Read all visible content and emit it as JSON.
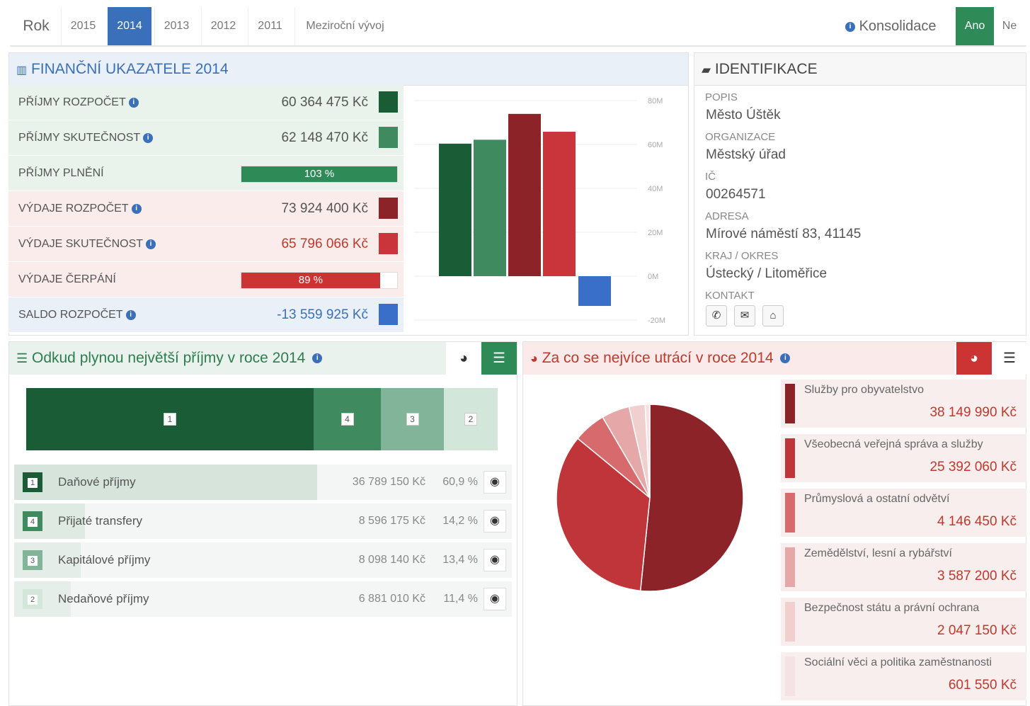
{
  "yearbar": {
    "label": "Rok",
    "years": [
      "2015",
      "2014",
      "2013",
      "2012",
      "2011",
      "Meziroční vývoj"
    ],
    "active_year": "2014",
    "consolidation_label": "Konsolidace",
    "yes_label": "Ano",
    "no_label": "Ne",
    "active_consolidation": "Ano"
  },
  "fin": {
    "title": "FINANČNÍ UKAZATELE 2014",
    "rows": [
      {
        "label": "PŘÍJMY ROZPOČET",
        "value": "60 364 475 Kč",
        "color": "#1a5c36"
      },
      {
        "label": "PŘÍJMY SKUTEČNOST",
        "value": "62 148 470 Kč",
        "color": "#3f8a5e"
      },
      {
        "label": "PŘÍJMY PLNĚNÍ",
        "bar_text": "103 %",
        "bar_fraction": 1.0,
        "color": "#2e8b57"
      },
      {
        "label": "VÝDAJE ROZPOČET",
        "value": "73 924 400 Kč",
        "color": "#8b2328"
      },
      {
        "label": "VÝDAJE SKUTEČNOST",
        "value": "65 796 066 Kč",
        "color": "#c9353a"
      },
      {
        "label": "VÝDAJE ČERPÁNÍ",
        "bar_text": "89 %",
        "bar_fraction": 0.89,
        "color": "#cc3333"
      },
      {
        "label": "SALDO ROZPOČET",
        "value": "-13 559 925 Kč",
        "color": "#3a6fc9"
      }
    ]
  },
  "chart_data": {
    "type": "bar",
    "categories": [
      "PŘÍJMY ROZPOČET",
      "PŘÍJMY SKUTEČNOST",
      "VÝDAJE ROZPOČET",
      "VÝDAJE SKUTEČNOST",
      "SALDO ROZPOČET"
    ],
    "values": [
      60364475,
      62148470,
      73924400,
      65796066,
      -13559925
    ],
    "colors": [
      "#1a5c36",
      "#3f8a5e",
      "#8b2328",
      "#c9353a",
      "#3a6fc9"
    ],
    "ylim": [
      -20000000,
      80000000
    ],
    "ytick_labels": [
      "80M",
      "60M",
      "40M",
      "20M",
      "0M",
      "-20M"
    ],
    "ytick_values": [
      80000000,
      60000000,
      40000000,
      20000000,
      0,
      -20000000
    ],
    "grid": true
  },
  "ident": {
    "title": "IDENTIFIKACE",
    "fields": [
      {
        "label": "POPIS",
        "value": "Město Úštěk"
      },
      {
        "label": "ORGANIZACE",
        "value": "Městský úřad"
      },
      {
        "label": "IČ",
        "value": "00264571"
      },
      {
        "label": "ADRESA",
        "value": "Mírové náměstí 83, 41145"
      },
      {
        "label": "KRAJ / OKRES",
        "value": "Ústecký / Litoměřice"
      }
    ],
    "contact_label": "KONTAKT",
    "contact_icons": [
      "phone-icon",
      "envelope-icon",
      "home-icon"
    ]
  },
  "income": {
    "title": "Odkud plynou největší příjmy v roce 2014",
    "segments": [
      {
        "num": "1",
        "share": 60.9,
        "color": "#1a5c36"
      },
      {
        "num": "4",
        "share": 14.2,
        "color": "#3f8a5e"
      },
      {
        "num": "3",
        "share": 13.4,
        "color": "#82b49a"
      },
      {
        "num": "2",
        "share": 11.4,
        "color": "#d3e6da"
      }
    ],
    "rows": [
      {
        "num": "1",
        "name": "Daňové příjmy",
        "amount": "36 789 150 Kč",
        "pct": "60,9 %",
        "share": 60.9,
        "color": "#1a5c36",
        "fill": "#d6e4db"
      },
      {
        "num": "4",
        "name": "Přijaté transfery",
        "amount": "8 596 175 Kč",
        "pct": "14,2 %",
        "share": 14.2,
        "color": "#3f8a5e",
        "fill": "#dfeae3"
      },
      {
        "num": "3",
        "name": "Kapitálové příjmy",
        "amount": "8 098 140 Kč",
        "pct": "13,4 %",
        "share": 13.4,
        "color": "#82b49a",
        "fill": "#e4ede7"
      },
      {
        "num": "2",
        "name": "Nedaňové příjmy",
        "amount": "6 881 010 Kč",
        "pct": "11,4 %",
        "share": 11.4,
        "color": "#d3e6da",
        "fill": "#e6eee9"
      }
    ]
  },
  "spend": {
    "title": "Za co se nejvíce utrácí v roce 2014",
    "items": [
      {
        "name": "Služby pro obyvatelstvo",
        "amount": "38 149 990 Kč",
        "value": 38149990,
        "color": "#8b2328"
      },
      {
        "name": "Všeobecná veřejná správa a služby",
        "amount": "25 392 060 Kč",
        "value": 25392060,
        "color": "#c0353a"
      },
      {
        "name": "Průmyslová a ostatní odvětví",
        "amount": "4 146 450 Kč",
        "value": 4146450,
        "color": "#d66a6d"
      },
      {
        "name": "Zemědělství, lesní a rybářství",
        "amount": "3 587 200 Kč",
        "value": 3587200,
        "color": "#e6a7a8"
      },
      {
        "name": "Bezpečnost státu a právní ochrana",
        "amount": "2 047 150 Kč",
        "value": 2047150,
        "color": "#f0cfcf"
      },
      {
        "name": "Sociální věci a politika zaměstnanosti",
        "amount": "601 550 Kč",
        "value": 601550,
        "color": "#f5e3e3"
      }
    ]
  }
}
